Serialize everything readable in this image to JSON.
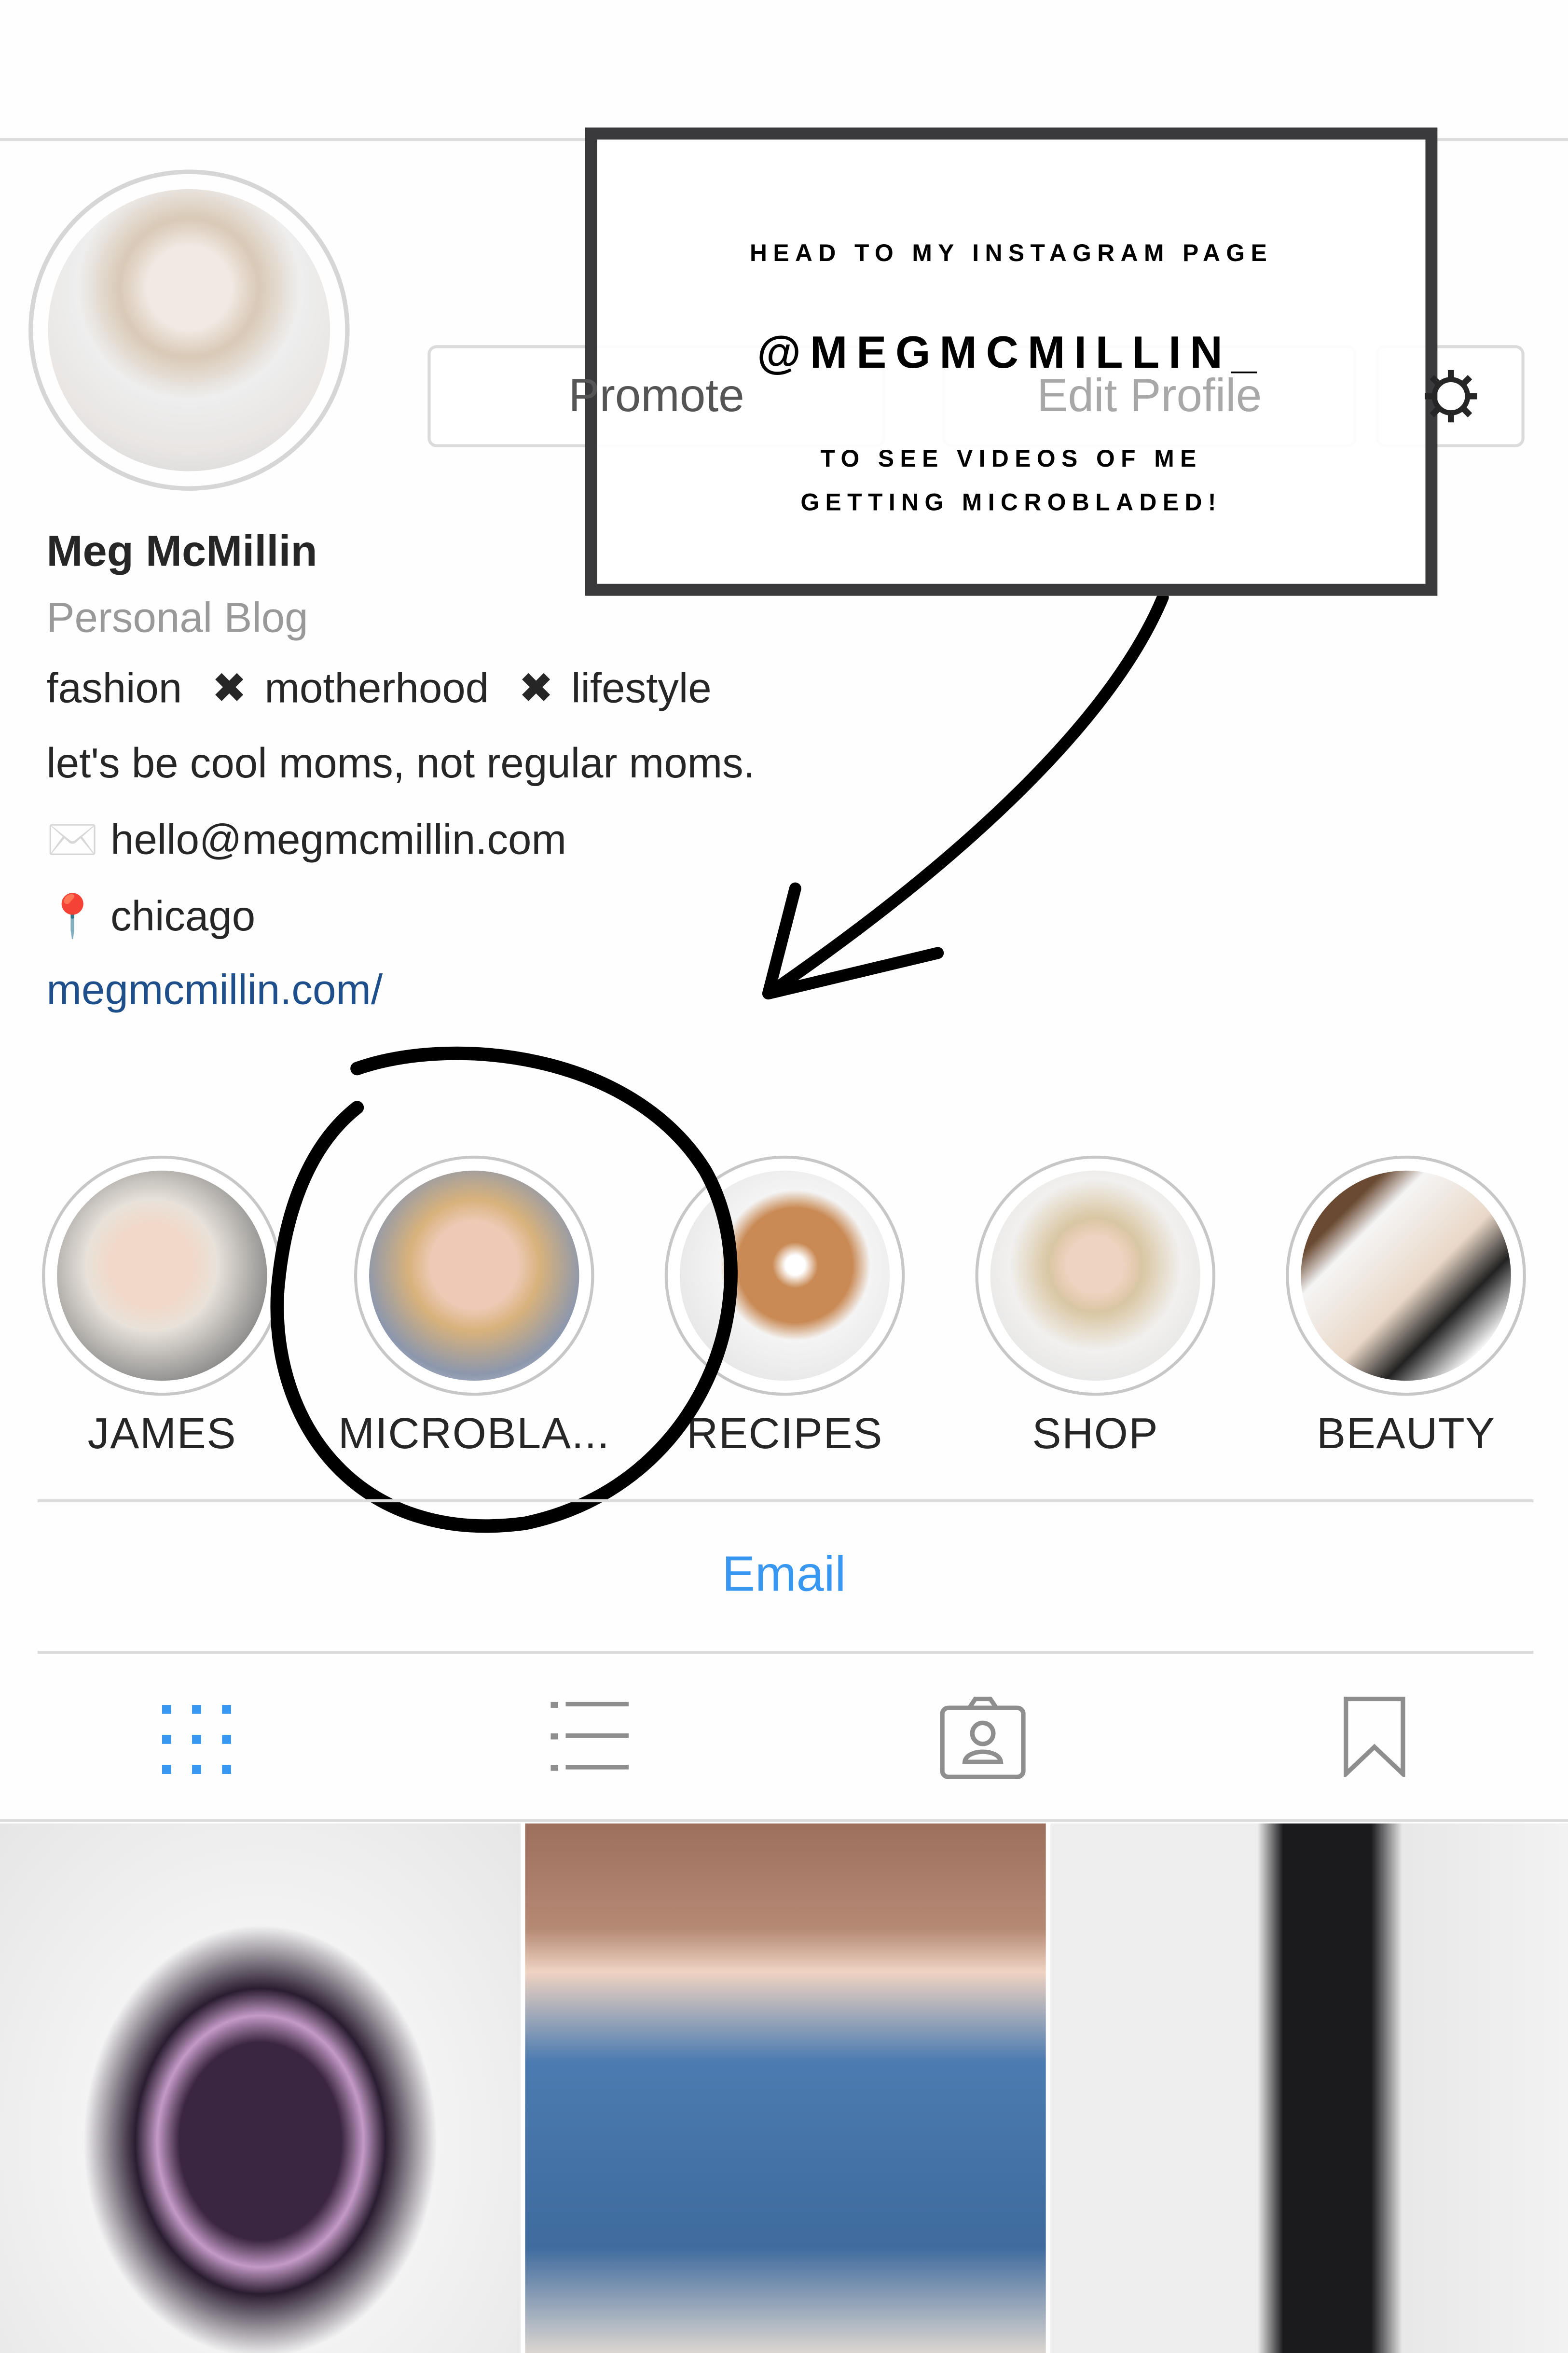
{
  "profile": {
    "name": "Meg McMillin",
    "category": "Personal Blog",
    "bio_line1": {
      "a": "fashion",
      "b": "motherhood",
      "c": "lifestyle",
      "separator": "✖"
    },
    "bio_line2": "let's be cool moms, not regular moms.",
    "email_icon": "✉️",
    "email": "hello@megmcmillin.com",
    "location_icon": "📍",
    "location": "chicago",
    "website": "megmcmillin.com/"
  },
  "buttons": {
    "promote": "Promote",
    "edit_profile": "Edit Profile",
    "settings_icon": "gear-icon"
  },
  "callout": {
    "line1": "HEAD TO MY INSTAGRAM PAGE",
    "handle": "@MEGMCMILLIN_",
    "line3": "TO SEE VIDEOS OF ME",
    "line4": "GETTING MICROBLADED!"
  },
  "highlights": [
    {
      "label": "JAMES"
    },
    {
      "label": "MICROBLA..."
    },
    {
      "label": "RECIPES"
    },
    {
      "label": "SHOP"
    },
    {
      "label": "BEAUTY"
    }
  ],
  "contact": {
    "email_button": "Email"
  },
  "tabs": [
    {
      "name": "grid",
      "icon": "grid-icon",
      "active": true
    },
    {
      "name": "list",
      "icon": "list-icon"
    },
    {
      "name": "tagged",
      "icon": "tagged-person-icon"
    },
    {
      "name": "saved",
      "icon": "bookmark-icon"
    }
  ],
  "colors": {
    "link": "#1f4f8a",
    "email_button": "#3897f0",
    "active_tab": "#3897f0",
    "callout_border": "#3a3a3c"
  }
}
